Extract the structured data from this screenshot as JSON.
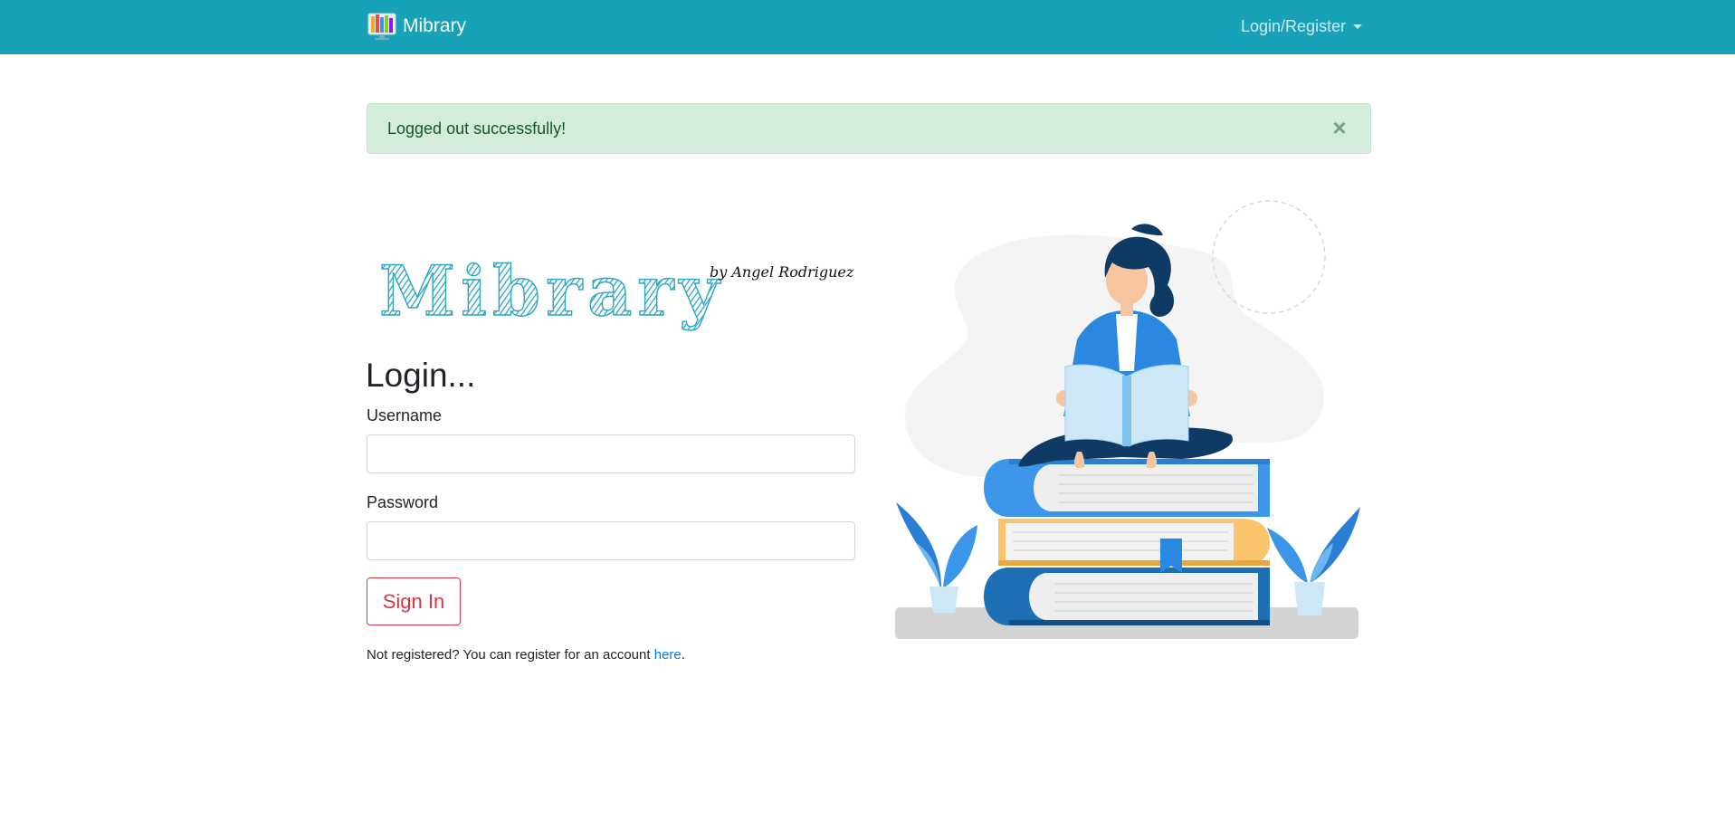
{
  "navbar": {
    "brand": "Mibrary",
    "dropdown_label": "Login/Register"
  },
  "alert": {
    "message": "Logged out successfully!",
    "close_symbol": "×"
  },
  "logo": {
    "title": "Mibrary",
    "byline": "by Angel Rodriguez",
    "color": "#2ba6c4"
  },
  "login": {
    "heading": "Login...",
    "username_label": "Username",
    "username_value": "",
    "password_label": "Password",
    "password_value": "",
    "submit_label": "Sign In",
    "register_prefix": "Not registered? You can register for an account ",
    "register_link": "here",
    "register_suffix": "."
  },
  "colors": {
    "navbar": "#17a2b8",
    "alert_bg": "#d4edda",
    "alert_text": "#155724",
    "danger": "#dc3545",
    "link": "#007bff"
  },
  "icons": {
    "brand_logo": "books-monitor-icon",
    "dropdown_caret": "caret-down-icon",
    "alert_close": "close-icon"
  }
}
